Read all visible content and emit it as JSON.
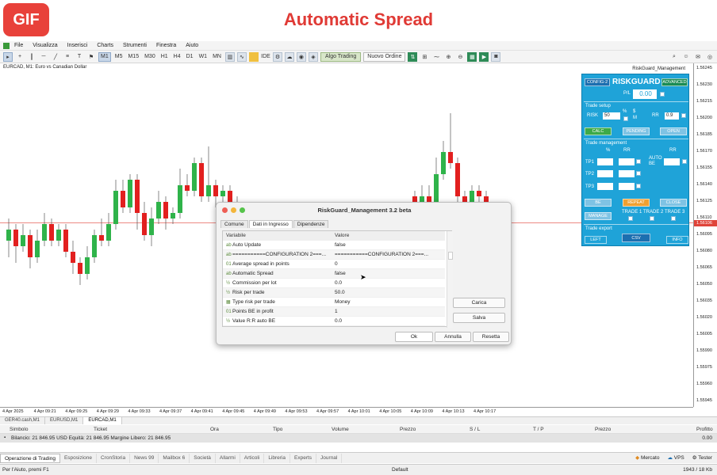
{
  "banner": {
    "badge": "GIF",
    "title": "Automatic Spread"
  },
  "menu": [
    "File",
    "Visualizza",
    "Inserisci",
    "Charts",
    "Strumenti",
    "Finestra",
    "Aiuto"
  ],
  "toolbar": {
    "timeframes": [
      "M1",
      "M5",
      "M15",
      "M30",
      "H1",
      "H4",
      "D1",
      "W1",
      "MN"
    ],
    "algo_trading": "Algo Trading",
    "new_order": "Nuovo Ordine",
    "ide": "IDE"
  },
  "chart": {
    "symbol_label": "EURCAD, M1:  Euro vs Canadian Dollar",
    "ea_label": "RiskGuard_Management",
    "price_ticks": [
      "1.56245",
      "1.56230",
      "1.56215",
      "1.56200",
      "1.56185",
      "1.56170",
      "1.56155",
      "1.56140",
      "1.56125",
      "1.56110",
      "1.56095",
      "1.56080",
      "1.56065",
      "1.56050",
      "1.56035",
      "1.56020",
      "1.56005",
      "1.55990",
      "1.55975",
      "1.55960",
      "1.55945"
    ],
    "current_price": "1.56106",
    "time_ticks": [
      "4 Apr 2025",
      "4 Apr 09:21",
      "4 Apr 09:25",
      "4 Apr 09:29",
      "4 Apr 09:33",
      "4 Apr 09:37",
      "4 Apr 09:41",
      "4 Apr 09:45",
      "4 Apr 09:49",
      "4 Apr 09:53",
      "4 Apr 09:57",
      "4 Apr 10:01",
      "4 Apr 10:05",
      "4 Apr 10:09",
      "4 Apr 10:13",
      "4 Apr 10:17"
    ],
    "candles": [
      {
        "o": 1.5609,
        "c": 1.561,
        "h": 1.5611,
        "l": 1.56075
      },
      {
        "o": 1.561,
        "c": 1.56085,
        "h": 1.56105,
        "l": 1.5607
      },
      {
        "o": 1.56085,
        "c": 1.56095,
        "h": 1.56105,
        "l": 1.5608
      },
      {
        "o": 1.56095,
        "c": 1.56075,
        "h": 1.561,
        "l": 1.56065
      },
      {
        "o": 1.56075,
        "c": 1.5609,
        "h": 1.561,
        "l": 1.5607
      },
      {
        "o": 1.5609,
        "c": 1.56105,
        "h": 1.56115,
        "l": 1.56085
      },
      {
        "o": 1.56105,
        "c": 1.5609,
        "h": 1.5611,
        "l": 1.56085
      },
      {
        "o": 1.5609,
        "c": 1.561,
        "h": 1.56105,
        "l": 1.56085
      },
      {
        "o": 1.561,
        "c": 1.5608,
        "h": 1.56105,
        "l": 1.56075
      },
      {
        "o": 1.5608,
        "c": 1.5607,
        "h": 1.5609,
        "l": 1.5606
      },
      {
        "o": 1.5607,
        "c": 1.5606,
        "h": 1.56075,
        "l": 1.5605
      },
      {
        "o": 1.5606,
        "c": 1.56075,
        "h": 1.56085,
        "l": 1.56055
      },
      {
        "o": 1.56075,
        "c": 1.56095,
        "h": 1.561,
        "l": 1.5607
      },
      {
        "o": 1.56095,
        "c": 1.5609,
        "h": 1.5611,
        "l": 1.56085
      },
      {
        "o": 1.5609,
        "c": 1.56105,
        "h": 1.56115,
        "l": 1.56085
      },
      {
        "o": 1.56105,
        "c": 1.56135,
        "h": 1.56145,
        "l": 1.561
      },
      {
        "o": 1.56135,
        "c": 1.5612,
        "h": 1.56145,
        "l": 1.56115
      },
      {
        "o": 1.5612,
        "c": 1.56145,
        "h": 1.5615,
        "l": 1.56115
      },
      {
        "o": 1.56145,
        "c": 1.56115,
        "h": 1.5615,
        "l": 1.561
      },
      {
        "o": 1.56115,
        "c": 1.56095,
        "h": 1.56125,
        "l": 1.5609
      },
      {
        "o": 1.56095,
        "c": 1.5611,
        "h": 1.5612,
        "l": 1.56085
      },
      {
        "o": 1.5611,
        "c": 1.56125,
        "h": 1.56135,
        "l": 1.56105
      },
      {
        "o": 1.56125,
        "c": 1.5611,
        "h": 1.5613,
        "l": 1.561
      },
      {
        "o": 1.5611,
        "c": 1.56115,
        "h": 1.5612,
        "l": 1.56105
      },
      {
        "o": 1.56115,
        "c": 1.5614,
        "h": 1.56155,
        "l": 1.5611
      },
      {
        "o": 1.5614,
        "c": 1.56135,
        "h": 1.5615,
        "l": 1.5613
      },
      {
        "o": 1.56135,
        "c": 1.5616,
        "h": 1.56165,
        "l": 1.5613
      },
      {
        "o": 1.5616,
        "c": 1.5613,
        "h": 1.56165,
        "l": 1.56125
      },
      {
        "o": 1.5613,
        "c": 1.5614,
        "h": 1.56175,
        "l": 1.56125
      },
      {
        "o": 1.5614,
        "c": 1.5613,
        "h": 1.56145,
        "l": 1.5612
      },
      {
        "o": 1.5613,
        "c": 1.56135,
        "h": 1.5614,
        "l": 1.5612
      },
      {
        "o": 1.56135,
        "c": 1.56125,
        "h": 1.5614,
        "l": 1.5612
      },
      {
        "o": 1.56125,
        "c": 1.5612,
        "h": 1.5613,
        "l": 1.5611
      }
    ],
    "candles_right": [
      {
        "o": 1.5613,
        "c": 1.5612,
        "h": 1.56135,
        "l": 1.56115
      },
      {
        "o": 1.5612,
        "c": 1.5613,
        "h": 1.5614,
        "l": 1.56115
      },
      {
        "o": 1.5613,
        "c": 1.56125,
        "h": 1.5614,
        "l": 1.5612
      },
      {
        "o": 1.56125,
        "c": 1.5615,
        "h": 1.56165,
        "l": 1.5612
      },
      {
        "o": 1.5615,
        "c": 1.5617,
        "h": 1.5618,
        "l": 1.56145
      },
      {
        "o": 1.5617,
        "c": 1.5616,
        "h": 1.56205,
        "l": 1.56155
      },
      {
        "o": 1.5616,
        "c": 1.5613,
        "h": 1.56165,
        "l": 1.56125
      },
      {
        "o": 1.5613,
        "c": 1.5612,
        "h": 1.56135,
        "l": 1.5611
      },
      {
        "o": 1.5612,
        "c": 1.56135,
        "h": 1.5614,
        "l": 1.56115
      },
      {
        "o": 1.56135,
        "c": 1.5613,
        "h": 1.5614,
        "l": 1.56125
      },
      {
        "o": 1.5613,
        "c": 1.56125,
        "h": 1.56135,
        "l": 1.5612
      }
    ],
    "colors": {
      "up": "#2fb34a",
      "down": "#e2201f"
    }
  },
  "riskguard": {
    "config": "CONFIG-2",
    "title": "RISKGUARD",
    "mode": "ADVANCED",
    "pl_label": "P/L",
    "pl_value": "0.00",
    "trade_setup": "Trade setup",
    "risk_label": "RISK",
    "risk_value": "50",
    "pct": "%",
    "dollar": "$",
    "m": "M",
    "rr_label": "RR",
    "rr_value": "0.9",
    "calc": "CALC",
    "pending": "PENDING",
    "open": "OPEN",
    "trade_management": "Trade management",
    "col_pct": "%",
    "col_rr": "RR",
    "col_rr2": "RR",
    "auto_be": "AUTO BE",
    "tp1": "TP1",
    "tp2": "TP2",
    "tp3": "TP3",
    "be": "BE",
    "repeat": "REPEAT",
    "close": "CLOSE",
    "manage": "MANAGE",
    "trade1": "TRADE 1",
    "trade2": "TRADE 2",
    "trade3": "TRADE 3",
    "trade_export": "Trade export",
    "left": "LEFT",
    "csv": "CSV",
    "info": "INFO"
  },
  "dialog": {
    "title": "RiskGuard_Management 3.2 beta",
    "tabs": [
      "Comune",
      "Dati in Ingresso",
      "Dipendenze"
    ],
    "header": [
      "Variabile",
      "Valore"
    ],
    "rows": [
      {
        "icon": "ab",
        "name": "Auto Update",
        "value": "false"
      },
      {
        "icon": "ab",
        "name": "===========CONFIGURATION 2===...",
        "value": "===========CONFIGURATION 2===..."
      },
      {
        "icon": "01",
        "name": "Average spread in points",
        "value": "0"
      },
      {
        "icon": "ab",
        "name": "Automatic Spread",
        "value": "false"
      },
      {
        "icon": "½",
        "name": "Commission per lot",
        "value": "0.0"
      },
      {
        "icon": "½",
        "name": "Risk per trade",
        "value": "50.0"
      },
      {
        "icon": "▦",
        "name": "Type risk per trade",
        "value": "Money"
      },
      {
        "icon": "01",
        "name": "Points BE in profit",
        "value": "1"
      },
      {
        "icon": "½",
        "name": "Value R:R auto BE",
        "value": "0.0"
      }
    ],
    "load": "Carica",
    "save": "Salva",
    "ok": "Ok",
    "cancel": "Annulla",
    "reset": "Resetta"
  },
  "chart_tabs": [
    "GER40.cash,M1",
    "EURUSD,M1",
    "EURCAD,M1"
  ],
  "trade": {
    "columns": [
      "Simbolo",
      "Ticket",
      "Ora",
      "Tipo",
      "Volume",
      "Prezzo",
      "S / L",
      "T / P",
      "Prezzo",
      "Profitto"
    ],
    "balance": "Bilancio: 21 846.95 USD  Equità: 21 846.95  Margine Libero: 21 846.95",
    "profit": "0.00"
  },
  "bottom_tabs": [
    "Operazione di Trading",
    "Esposizione",
    "CronStoria",
    "News 99",
    "Mailbox 6",
    "Società",
    "Allarmi",
    "Articoli",
    "Libreria",
    "Experts",
    "Journal"
  ],
  "bottom_right": [
    "Mercato",
    "VPS",
    "Tester"
  ],
  "status": {
    "left": "Per l'Aiuto, premi F1",
    "mid": "Default",
    "right": "1943 / 18 Kb"
  }
}
